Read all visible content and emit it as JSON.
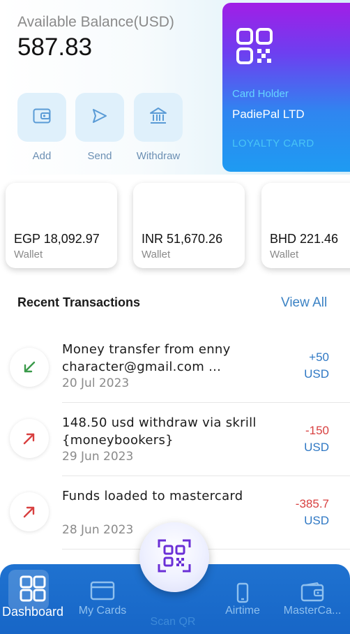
{
  "balance": {
    "label": "Available Balance(USD)",
    "value": "587.83"
  },
  "actions": [
    {
      "label": "Add",
      "icon": "wallet-add-icon"
    },
    {
      "label": "Send",
      "icon": "send-icon"
    },
    {
      "label": "Withdraw",
      "icon": "bank-icon"
    }
  ],
  "card": {
    "holder_label": "Card Holder",
    "holder_name": "PadiePal LTD",
    "type": "LOYALTY CARD",
    "icon": "qr-code-icon"
  },
  "wallets": [
    {
      "amount": "EGP 18,092.97",
      "label": "Wallet"
    },
    {
      "amount": "INR 51,670.26",
      "label": "Wallet"
    },
    {
      "amount": "BHD 221.46",
      "label": "Wallet"
    }
  ],
  "transactions_section": {
    "title": "Recent Transactions",
    "view_all": "View All"
  },
  "transactions": [
    {
      "title": "Money transfer from enny character@gmail.com ...",
      "date": "20 Jul 2023",
      "amount": "+50",
      "currency": "USD",
      "direction": "incoming",
      "icon": "arrow-down-left-icon"
    },
    {
      "title": "148.50 usd withdraw via skrill {moneybookers}",
      "date": "29 Jun 2023",
      "amount": "-150",
      "currency": "USD",
      "direction": "outgoing",
      "icon": "arrow-up-right-icon"
    },
    {
      "title": "Funds loaded to mastercard",
      "date": "28 Jun 2023",
      "amount": "-385.7",
      "currency": "USD",
      "direction": "outgoing",
      "icon": "arrow-up-right-icon"
    }
  ],
  "nav": {
    "items": [
      {
        "label": "Dashboard",
        "icon": "dashboard-icon",
        "active": true
      },
      {
        "label": "My Cards",
        "icon": "card-icon",
        "active": false
      },
      {
        "label": "Scan QR",
        "icon": "qr-scan-icon",
        "active": false
      },
      {
        "label": "Airtime",
        "icon": "phone-icon",
        "active": false
      },
      {
        "label": "MasterCa...",
        "icon": "wallet-icon",
        "active": false
      }
    ]
  },
  "colors": {
    "accent": "#1f72d0",
    "positive": "#2f78c4",
    "negative": "#d84040",
    "incoming_arrow": "#3a9a4a",
    "outgoing_arrow": "#d84040"
  }
}
